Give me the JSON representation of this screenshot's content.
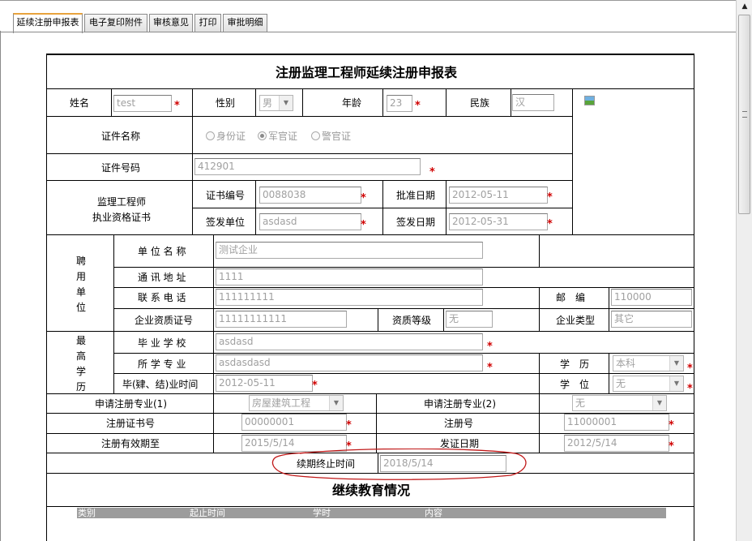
{
  "tabs": [
    "延续注册申报表",
    "电子复印附件",
    "审核意见",
    "打印",
    "审批明细"
  ],
  "form": {
    "title": "注册监理工程师延续注册申报表",
    "name": {
      "label": "姓名",
      "value": "test"
    },
    "gender": {
      "label": "性别",
      "value": "男"
    },
    "age": {
      "label": "年龄",
      "value": "23"
    },
    "ethnicity": {
      "label": "民族",
      "value": "汉"
    },
    "cert_type": {
      "label": "证件名称",
      "options": [
        "身份证",
        "军官证",
        "警官证"
      ],
      "selected": "军官证"
    },
    "id_number": {
      "label": "证件号码",
      "value": "412901"
    },
    "qual_cert": {
      "label_line1": "监理工程师",
      "label_line2": "执业资格证书",
      "cert_no": {
        "label": "证书编号",
        "value": "0088038"
      },
      "approve_date": {
        "label": "批准日期",
        "value": "2012-05-11"
      },
      "issuer": {
        "label": "签发单位",
        "value": "asdasd"
      },
      "issue_date": {
        "label": "签发日期",
        "value": "2012-05-31"
      }
    },
    "employer": {
      "side_label": [
        "聘",
        "用",
        "单",
        "位"
      ],
      "unit_name": {
        "label": "单 位 名 称",
        "value": "测试企业"
      },
      "address": {
        "label": "通 讯 地 址",
        "value": "1111"
      },
      "phone": {
        "label": "联 系 电 话",
        "value": "111111111"
      },
      "postcode": {
        "label": "邮　编",
        "value": "110000"
      },
      "qual_no": {
        "label": "企业资质证号",
        "value": "11111111111"
      },
      "qual_level": {
        "label": "资质等级",
        "value": "无"
      },
      "ent_type": {
        "label": "企业类型",
        "value": "其它"
      }
    },
    "education": {
      "side_label": [
        "最",
        "高",
        "学",
        "历"
      ],
      "school": {
        "label": "毕 业 学 校",
        "value": "asdasd"
      },
      "major": {
        "label": "所 学 专 业",
        "value": "asdasdasd"
      },
      "degree_level": {
        "label": "学　历",
        "value": "本科"
      },
      "grad_time": {
        "label": "毕(肄、结)业时间",
        "value": "2012-05-11"
      },
      "degree": {
        "label": "学　位",
        "value": "无"
      }
    },
    "reg": {
      "major1": {
        "label": "申请注册专业(1)",
        "value": "房屋建筑工程"
      },
      "major2": {
        "label": "申请注册专业(2)",
        "value": "无"
      },
      "cert_no": {
        "label": "注册证书号",
        "value": "00000001"
      },
      "reg_no": {
        "label": "注册号",
        "value": "11000001"
      },
      "valid_until": {
        "label": "注册有效期至",
        "value": "2015/5/14"
      },
      "issue_date": {
        "label": "发证日期",
        "value": "2012/5/14"
      },
      "renew_end": {
        "label": "续期终止时间",
        "value": "2018/5/14"
      }
    },
    "edu_section": {
      "title": "继续教育情况",
      "headers": [
        "类别",
        "起止时间",
        "学时",
        "内容"
      ]
    }
  },
  "colors": {
    "required": "#d00000",
    "tab_active_accent": "#e8a33d",
    "annotation": "#c01818"
  }
}
